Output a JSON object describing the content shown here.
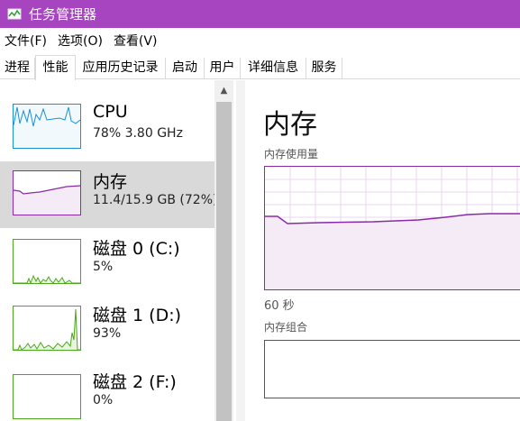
{
  "window": {
    "title": "任务管理器"
  },
  "menu": [
    "文件(F)",
    "选项(O)",
    "查看(V)"
  ],
  "tabs": [
    "进程",
    "性能",
    "应用历史记录",
    "启动",
    "用户",
    "详细信息",
    "服务"
  ],
  "active_tab": "性能",
  "sidebar": {
    "items": [
      {
        "name": "CPU",
        "sub": "78%  3.80 GHz",
        "color": "#1b8fd6"
      },
      {
        "name": "内存",
        "sub": "11.4/15.9 GB (72%)",
        "color": "#8b2aa8"
      },
      {
        "name": "磁盘 0 (C:)",
        "sub": "5%",
        "color": "#4ca81e"
      },
      {
        "name": "磁盘 1 (D:)",
        "sub": "93%",
        "color": "#4ca81e"
      },
      {
        "name": "磁盘 2 (F:)",
        "sub": "0%",
        "color": "#4ca81e"
      }
    ],
    "selected": "内存"
  },
  "detail": {
    "title": "内存",
    "usage_label": "内存使用量",
    "time_label": "60 秒",
    "composition_label": "内存组合",
    "accent": "#8b2aa8",
    "grid_color": "#ead7ef"
  },
  "colors": {
    "titlebar": "#a645bf",
    "selected_item": "#d9d9d9"
  }
}
